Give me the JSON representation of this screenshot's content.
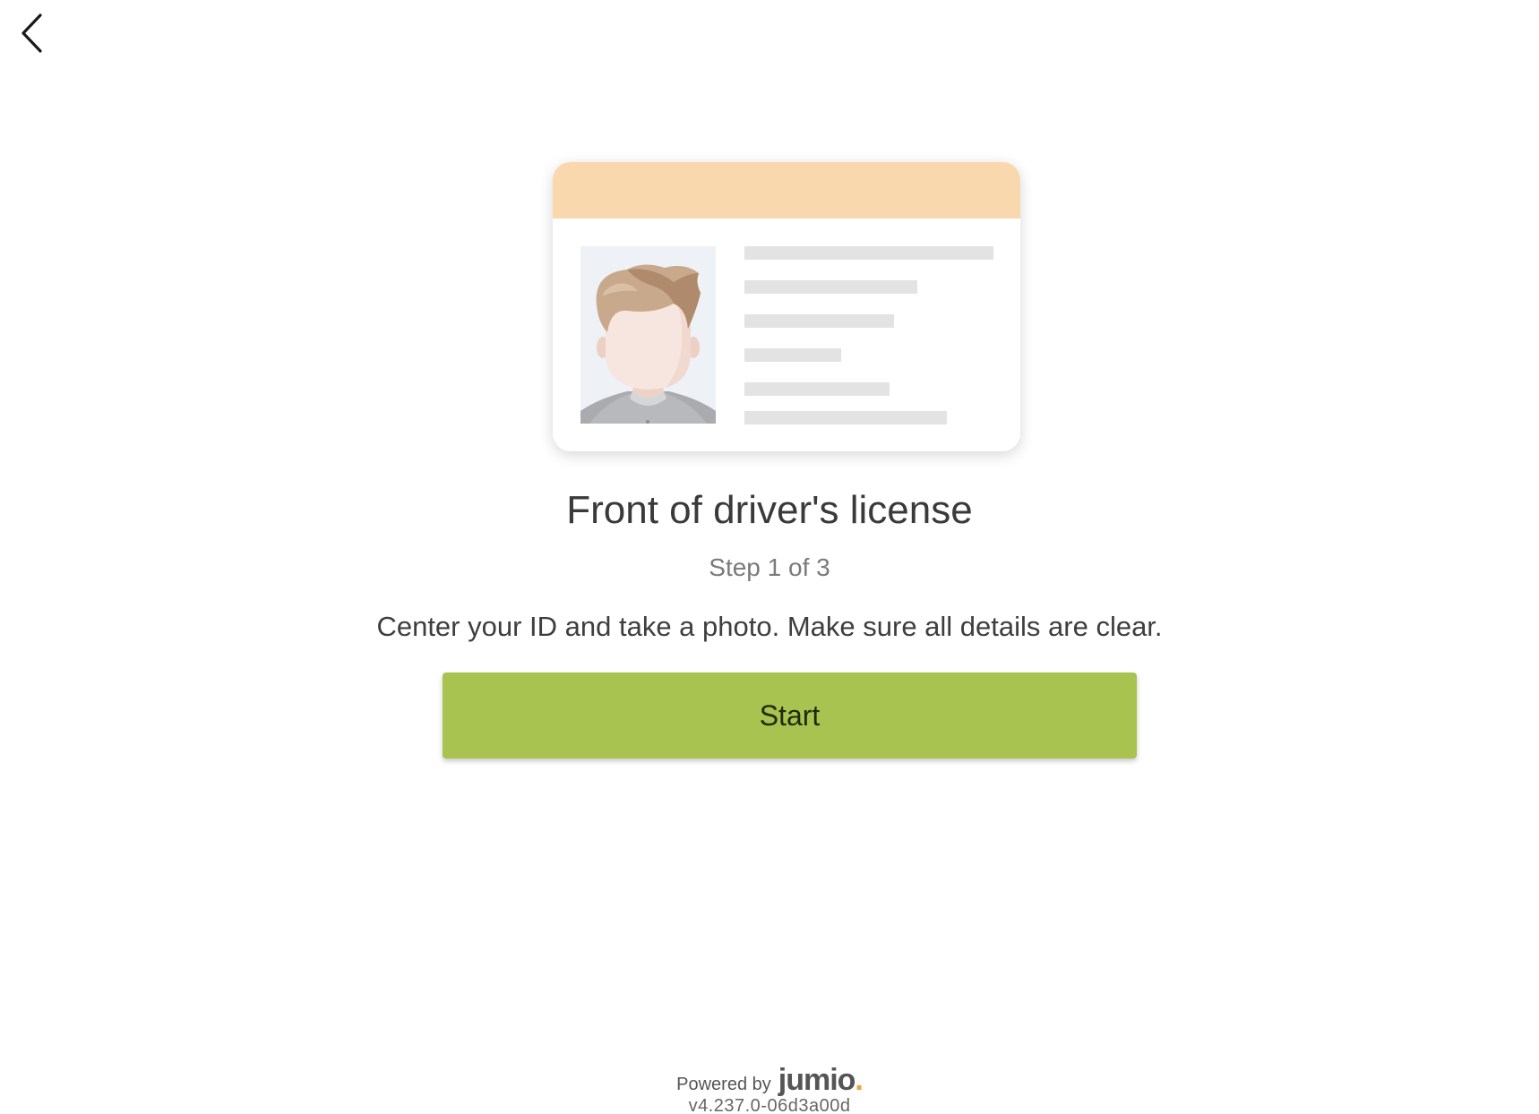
{
  "header": {
    "back_icon": "chevron-left-icon"
  },
  "illustration": {
    "card_header_color": "#fad8ae",
    "card_line_color": "#e3e3e3",
    "photo_background": "#eef1f6",
    "avatar_icon": "person-avatar-icon"
  },
  "main": {
    "title": "Front of driver's license",
    "step": "Step 1 of 3",
    "instructions": "Center your ID and take a photo. Make sure all details are clear.",
    "start_label": "Start",
    "accent_color": "#a8c350"
  },
  "footer": {
    "powered_by": "Powered by",
    "brand": "jumio",
    "version": "v4.237.0-06d3a00d"
  }
}
